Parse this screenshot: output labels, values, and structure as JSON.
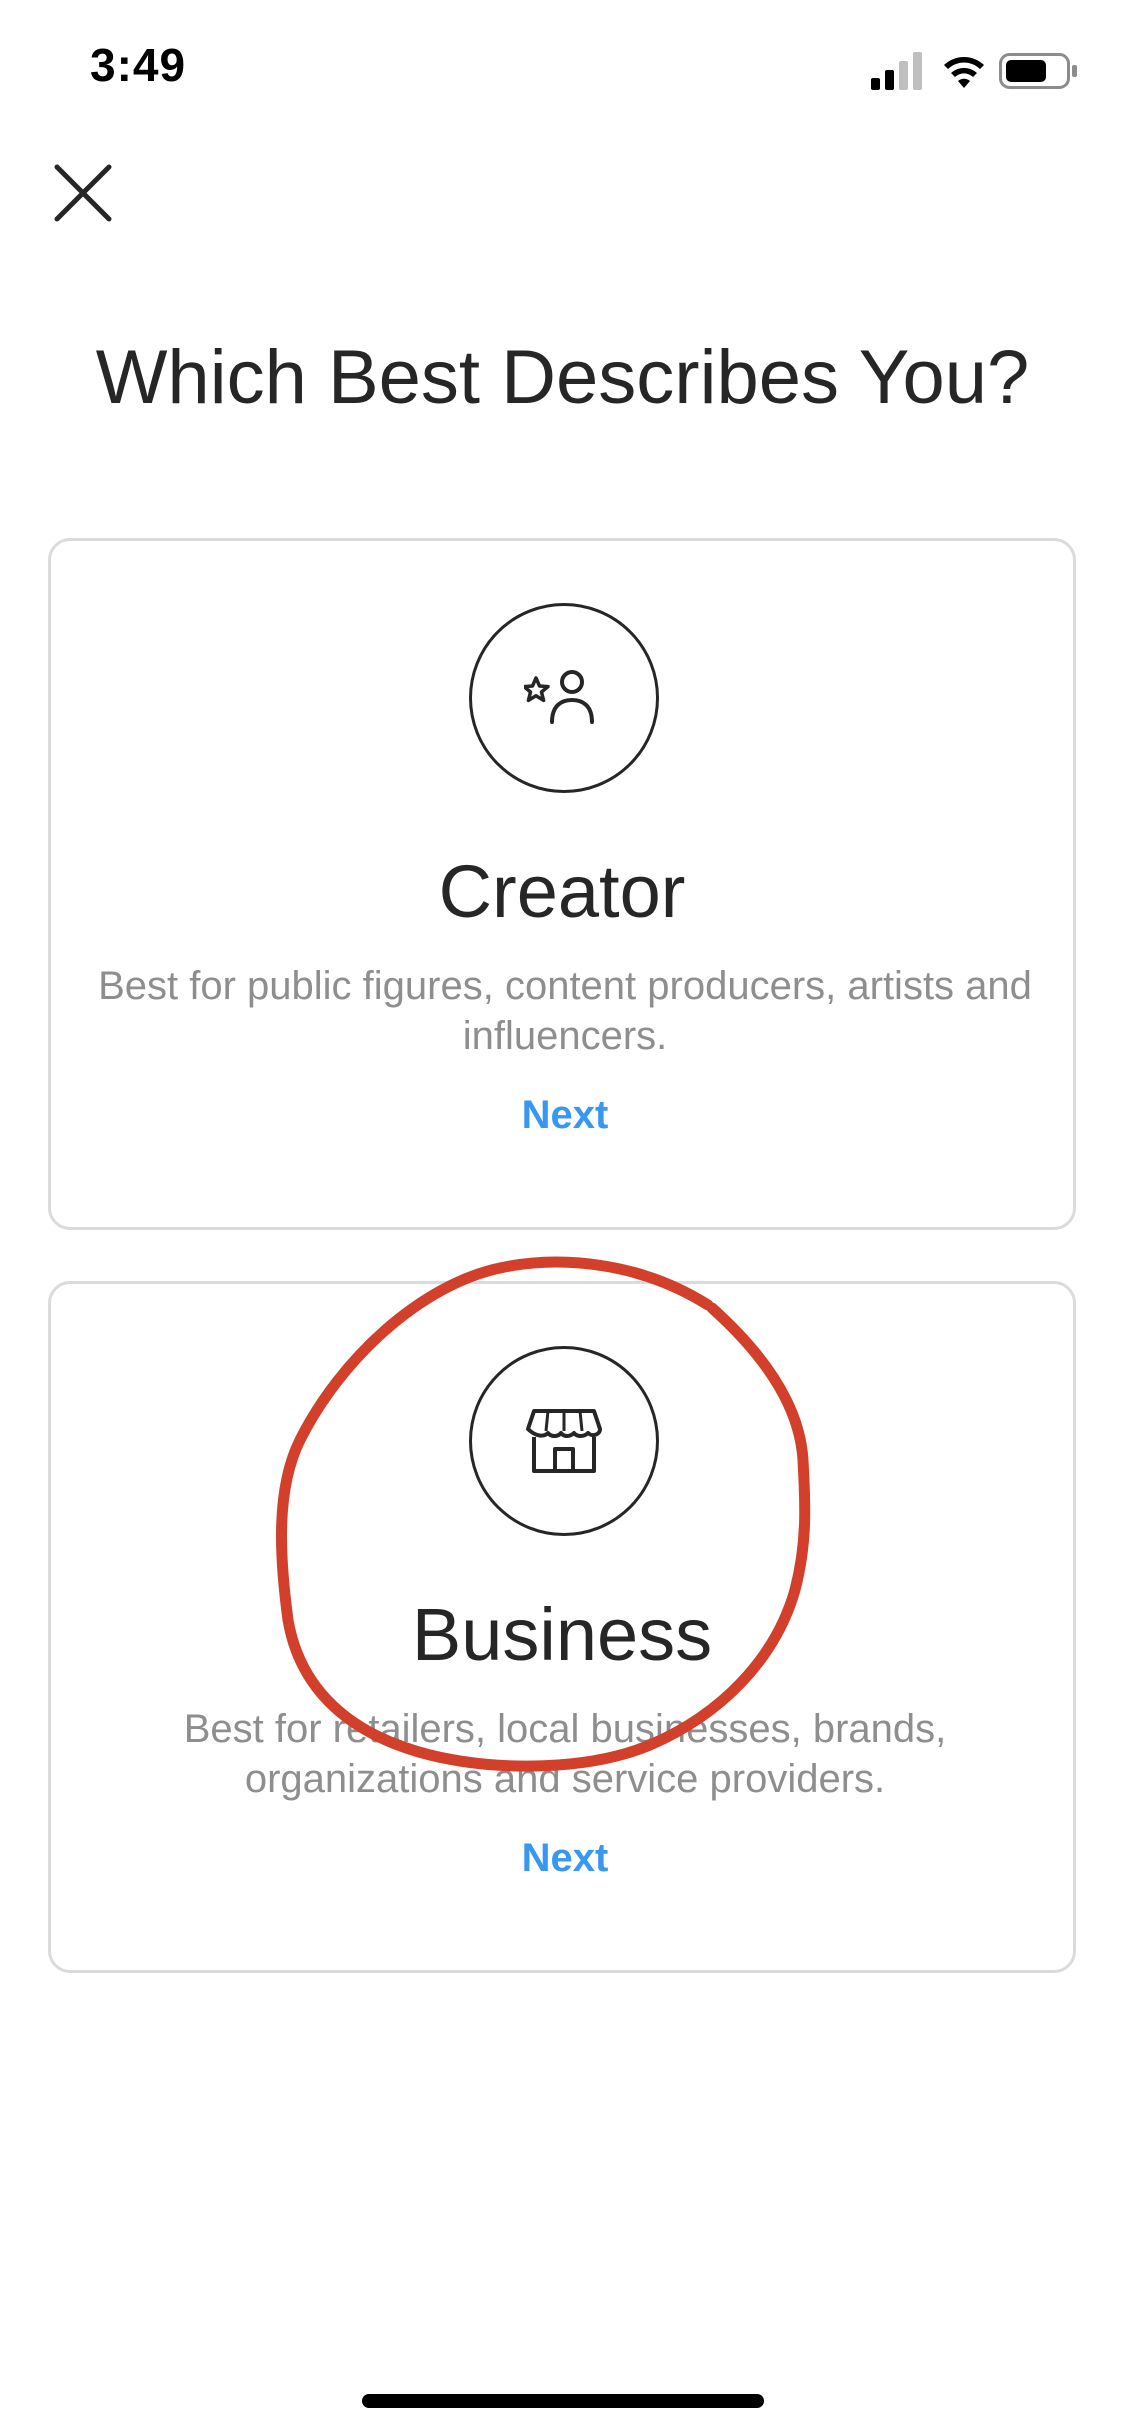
{
  "status_bar": {
    "time": "3:49"
  },
  "header": {
    "close_icon": "close-icon"
  },
  "title": "Which Best Describes You?",
  "cards": [
    {
      "icon": "star-person-icon",
      "title": "Creator",
      "description": "Best for public figures, content producers, artists and influencers.",
      "next_label": "Next"
    },
    {
      "icon": "storefront-icon",
      "title": "Business",
      "description": "Best for retailers, local businesses, brands, organizations and service providers.",
      "next_label": "Next"
    }
  ],
  "colors": {
    "accent": "#3897f0",
    "text_primary": "#262626",
    "text_secondary": "#8e8e8e",
    "border": "#dbdbdb",
    "annotation": "#d2402c"
  }
}
